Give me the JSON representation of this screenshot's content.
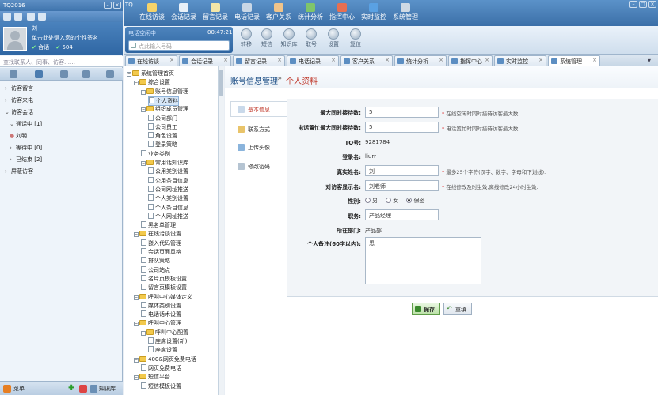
{
  "app": {
    "title": "TQ2016",
    "brand": "TQ"
  },
  "profile": {
    "name": "刘",
    "signature": "单击此处键入您的个性签名",
    "status": "合话",
    "count": "504"
  },
  "left_search": {
    "placeholder": "查找联系人、同事、访客……"
  },
  "left_tree": [
    {
      "label": "访客留言",
      "count": ""
    },
    {
      "label": "访客来电",
      "count": ""
    },
    {
      "label": "访客会话",
      "count": ""
    },
    {
      "label": "通话中",
      "count": "[1]"
    },
    {
      "label": "刘明",
      "count": ""
    },
    {
      "label": "等待中",
      "count": "[0]"
    },
    {
      "label": "已结束",
      "count": "[2]"
    },
    {
      "label": "屏蔽访客",
      "count": ""
    }
  ],
  "left_bottom": {
    "menu": "菜单",
    "kb": "知识库"
  },
  "top_nav": [
    "在线访谈",
    "会话记录",
    "留言记录",
    "电话记录",
    "客户关系",
    "统计分析",
    "指挥中心",
    "实时监控",
    "系统管理"
  ],
  "phone": {
    "status": "电话空闲中",
    "time": "00:47:21",
    "placeholder": "点此输入号码",
    "buttons": [
      "转移",
      "短信",
      "知识库",
      "取号",
      "设置",
      "复位"
    ]
  },
  "tabs": [
    "在线访谈",
    "会话记录",
    "留言记录",
    "电话记录",
    "客户关系",
    "统计分析",
    "指挥中心",
    "实时监控",
    "系统管理"
  ],
  "system_tree": [
    "系统管理首页",
    "综合设置",
    "账号信息管理",
    "个人资料",
    "组织成员管理",
    "公司部门",
    "公司员工",
    "角色设置",
    "登录策略",
    "业务类别",
    "常用话知识库",
    "公用类别设置",
    "公用条目信息",
    "公司网址推送",
    "个人类别设置",
    "个人条目信息",
    "个人网址推送",
    "黑名单管理",
    "在线洽谈设置",
    "嵌入代码管理",
    "会话页面风格",
    "排队策略",
    "公司站点",
    "名片页模板设置",
    "留言页模板设置",
    "呼叫中心媒体定义",
    "媒体类别设置",
    "电话话术设置",
    "呼叫中心管理",
    "呼叫中心配置",
    "座席设置(新)",
    "座席设置",
    "400&网页免费电话",
    "网页免费电话",
    "短信平台",
    "短信模板设置"
  ],
  "breadcrumb": {
    "section": "账号信息管理",
    "sep": "»",
    "page": "个人资料"
  },
  "side_nav": [
    "基本信息",
    "联系方式",
    "上传头像",
    "修改密码"
  ],
  "form": {
    "max_online": {
      "label": "最大同时接待数:",
      "value": "5",
      "hint": "在线空闲时同时接待访客最大数."
    },
    "max_busy": {
      "label": "电话置忙最大同时接待数:",
      "value": "5",
      "hint": "电话置忙时同时接待访客最大数."
    },
    "tq_no": {
      "label": "TQ号:",
      "value": "9281784"
    },
    "login_name": {
      "label": "登录名:",
      "value": "liurr"
    },
    "real_name": {
      "label": "真实姓名:",
      "value": "刘",
      "hint": "最多25个字符(汉字、数字、字母和下划线)."
    },
    "visitor_name": {
      "label": "对访客显示名:",
      "value": "刘老师",
      "hint": "在线修改及时生效,离线修改24小时生效."
    },
    "gender": {
      "label": "性别:",
      "options": [
        "男",
        "女",
        "保密"
      ],
      "selected": "保密"
    },
    "job": {
      "label": "职务:",
      "value": "产品经理"
    },
    "dept": {
      "label": "所在部门:",
      "value": "产品部"
    },
    "remark": {
      "label": "个人备注(60字以内):",
      "value": "恩"
    }
  },
  "buttons": {
    "save": "保存",
    "reset": "重填"
  },
  "colors": {
    "accent": "#3b6fa8",
    "breadcrumb_page": "#c0392b",
    "required": "#dd3333"
  }
}
